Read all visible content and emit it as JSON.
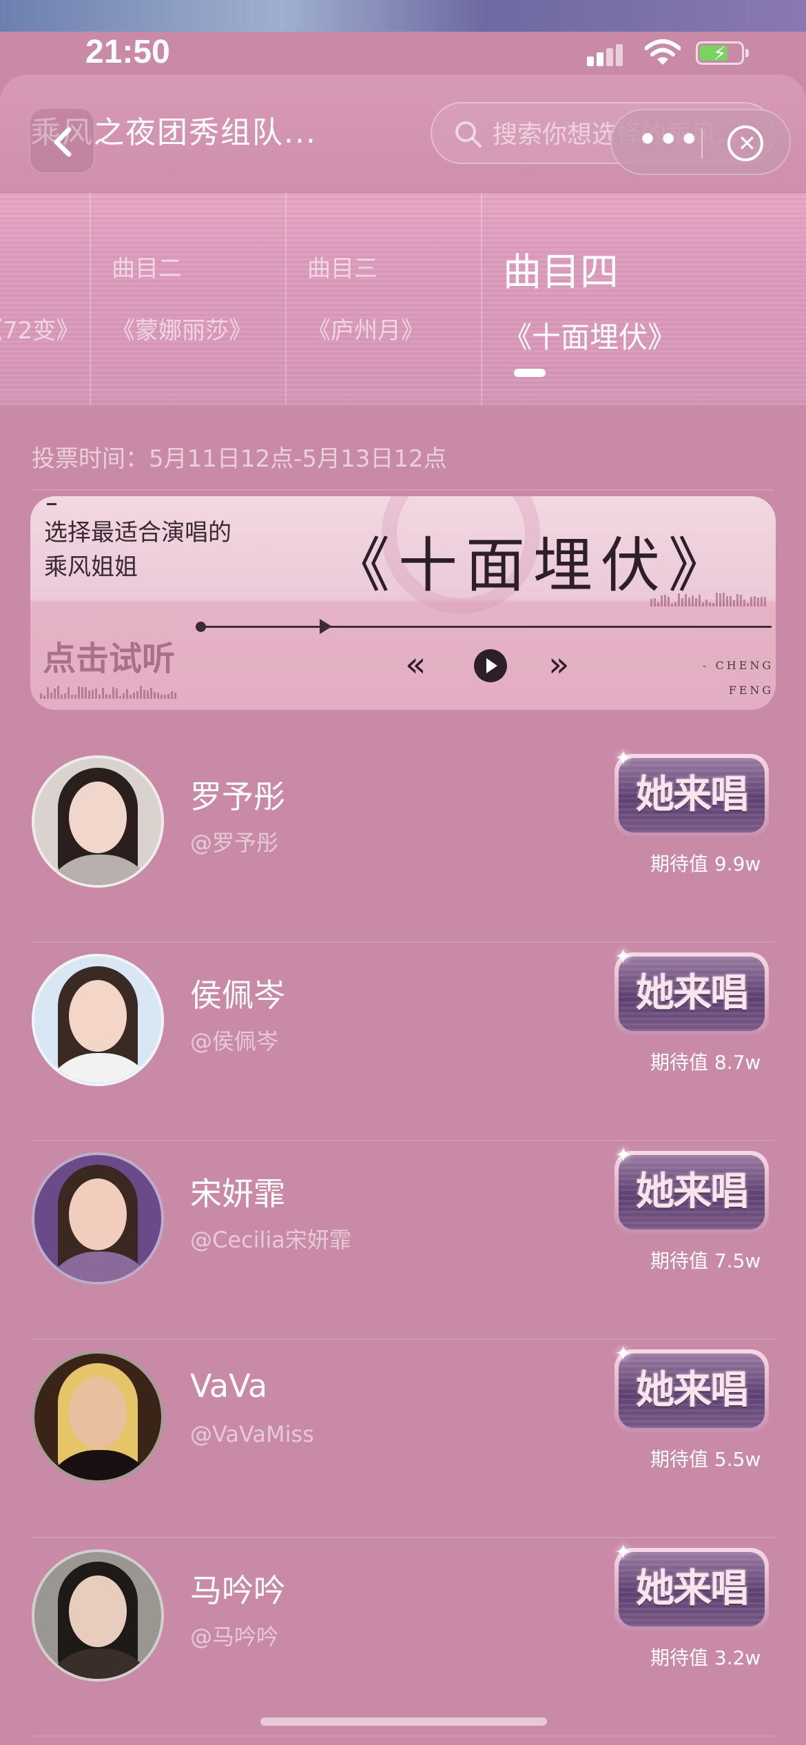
{
  "status_bar": {
    "time": "21:50"
  },
  "header": {
    "title": "乘风之夜团秀组队...",
    "search_placeholder": "搜索你想选择的乘风...",
    "more_label": "•••",
    "close_label": "✕"
  },
  "tracks": [
    {
      "num": "",
      "song": "《72变》",
      "active": false
    },
    {
      "num": "曲目二",
      "song": "《蒙娜丽莎》",
      "active": false
    },
    {
      "num": "曲目三",
      "song": "《庐州月》",
      "active": false
    },
    {
      "num": "曲目四",
      "song": "《十面埋伏》",
      "active": true
    }
  ],
  "vote_time": "投票时间：5月11日12点-5月13日12点",
  "player": {
    "tagline_line1": "选择最适合演唱的",
    "tagline_line2": "乘风姐姐",
    "song_title": "《十面埋伏》",
    "listen_label": "点击试听",
    "brand_line1": "- CHENG",
    "brand_line2": "FENG",
    "progress": 0.21
  },
  "sing_button_label": "她来唱",
  "artists": [
    {
      "name": "罗予彤",
      "handle": "@罗予彤",
      "expect": "期待值  9.9w",
      "avatar_colors": [
        "#d9d2cf",
        "#2a1f1c",
        "#f1d6cc",
        "#b9b0ad"
      ]
    },
    {
      "name": "侯佩岑",
      "handle": "@侯佩岑",
      "expect": "期待值  8.7w",
      "avatar_colors": [
        "#d9e6f4",
        "#3a2a24",
        "#f4d6c8",
        "#f2f2f2"
      ]
    },
    {
      "name": "宋妍霏",
      "handle": "@Cecilia宋妍霏",
      "expect": "期待值  7.5w",
      "avatar_colors": [
        "#6b4a8a",
        "#3b2820",
        "#f0cdbd",
        "#8a6a9a"
      ]
    },
    {
      "name": "VaVa",
      "handle": "@VaVaMiss",
      "expect": "期待值  5.5w",
      "avatar_colors": [
        "#3a2418",
        "#e6c46a",
        "#e8c0a0",
        "#181010"
      ]
    },
    {
      "name": "马吟吟",
      "handle": "@马吟吟",
      "expect": "期待值  3.2w",
      "avatar_colors": [
        "#9a9692",
        "#1e1a18",
        "#e8cdbf",
        "#3a2e28"
      ]
    }
  ]
}
